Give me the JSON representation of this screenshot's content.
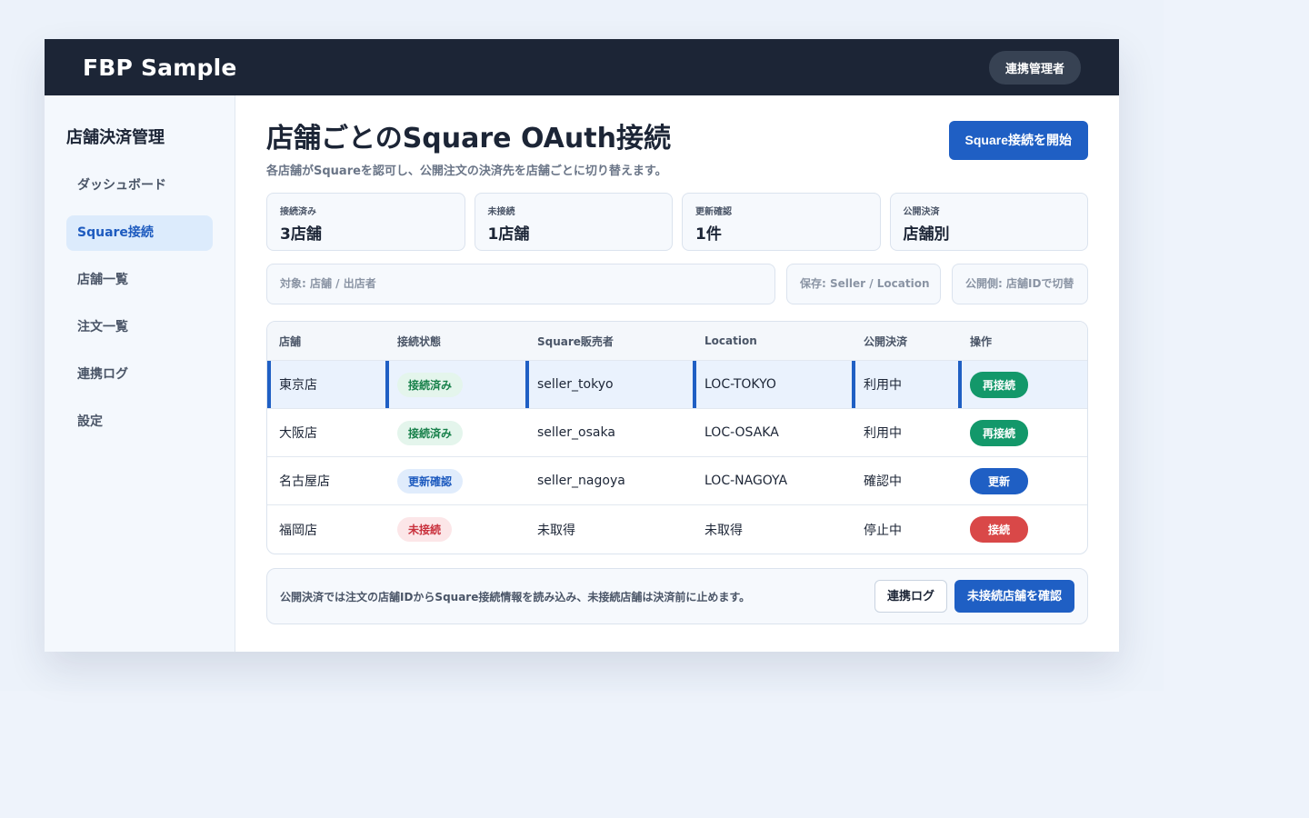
{
  "app": {
    "brand": "FBP Sample",
    "role_badge": "連携管理者"
  },
  "sidebar": {
    "title": "店舗決済管理",
    "items": [
      {
        "label": "ダッシュボード",
        "active": false
      },
      {
        "label": "Square接続",
        "active": true
      },
      {
        "label": "店舗一覧",
        "active": false
      },
      {
        "label": "注文一覧",
        "active": false
      },
      {
        "label": "連携ログ",
        "active": false
      },
      {
        "label": "設定",
        "active": false
      }
    ]
  },
  "header": {
    "title": "店舗ごとのSquare OAuth接続",
    "subtitle": "各店舗がSquareを認可し、公開注文の決済先を店舗ごとに切り替えます。",
    "primary_action": "Square接続を開始"
  },
  "stats": [
    {
      "label": "接続済み",
      "value": "3店舗"
    },
    {
      "label": "未接続",
      "value": "1店舗"
    },
    {
      "label": "更新確認",
      "value": "1件"
    },
    {
      "label": "公開決済",
      "value": "店舗別"
    }
  ],
  "filters": {
    "target": "対象: 店舗 / 出店者",
    "storage": "保存: Seller / Location",
    "public_side": "公開側: 店舗IDで切替"
  },
  "table": {
    "headers": [
      "店舗",
      "接続状態",
      "Square販売者",
      "Location",
      "公開決済",
      "操作"
    ],
    "rows": [
      {
        "store": "東京店",
        "status": "接続済み",
        "status_color": "green",
        "seller": "seller_tokyo",
        "location": "LOC-TOKYO",
        "payment": "利用中",
        "action": "再接続",
        "action_color": "green",
        "selected": true
      },
      {
        "store": "大阪店",
        "status": "接続済み",
        "status_color": "green",
        "seller": "seller_osaka",
        "location": "LOC-OSAKA",
        "payment": "利用中",
        "action": "再接続",
        "action_color": "green",
        "selected": false
      },
      {
        "store": "名古屋店",
        "status": "更新確認",
        "status_color": "blue",
        "seller": "seller_nagoya",
        "location": "LOC-NAGOYA",
        "payment": "確認中",
        "action": "更新",
        "action_color": "blue",
        "selected": false
      },
      {
        "store": "福岡店",
        "status": "未接続",
        "status_color": "red",
        "seller": "未取得",
        "location": "未取得",
        "payment": "停止中",
        "action": "接続",
        "action_color": "red",
        "selected": false
      }
    ]
  },
  "footer": {
    "note": "公開決済では注文の店舗IDからSquare接続情報を読み込み、未接続店舗は決済前に止めます。",
    "log_button": "連携ログ",
    "check_button": "未接続店舗を確認"
  },
  "colors": {
    "topbar": "#1c2536",
    "accent": "#1f5fc4",
    "success": "#13986a",
    "danger": "#d94848"
  }
}
